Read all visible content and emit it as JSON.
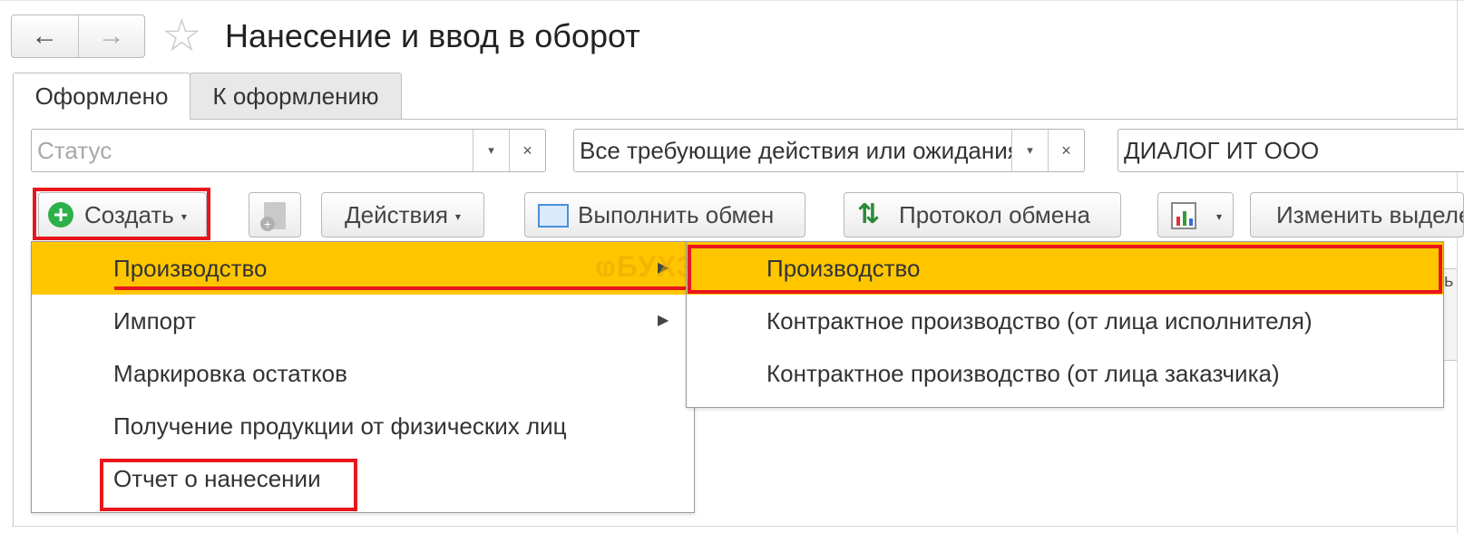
{
  "window": {
    "title": "Нанесение и ввод в оборот",
    "nav": {
      "back_icon": "←",
      "forward_icon": "→"
    },
    "star_icon": "☆"
  },
  "tabs": [
    {
      "label": "Оформлено",
      "active": true
    },
    {
      "label": "К оформлению",
      "active": false
    }
  ],
  "filters": {
    "status": {
      "value": "",
      "placeholder": "Статус"
    },
    "state": {
      "value": "Все требующие действия или ожидания"
    },
    "organization": {
      "value": "ДИАЛОГ ИТ ООО"
    },
    "dropdown_glyph": "▾",
    "clear_glyph": "×"
  },
  "toolbar": {
    "create_label": "Создать",
    "actions_label": "Действия",
    "exchange_label": "Выполнить обмен",
    "protocol_label": "Протокол обмена",
    "change_label": "Изменить выделенные",
    "dropdown_glyph": "▾",
    "plus_glyph": "+"
  },
  "create_menu": {
    "items": [
      {
        "label": "Производство",
        "has_submenu": true,
        "highlighted": true
      },
      {
        "label": "Импорт",
        "has_submenu": true,
        "highlighted": false
      },
      {
        "label": "Маркировка остатков",
        "has_submenu": false,
        "highlighted": false
      },
      {
        "label": "Получение продукции от физических лиц",
        "has_submenu": false,
        "highlighted": false
      },
      {
        "label": "Отчет о нанесении",
        "has_submenu": false,
        "highlighted": false
      }
    ],
    "submenu_arrow": "▶"
  },
  "submenu": {
    "items": [
      {
        "label": "Производство",
        "highlighted": true
      },
      {
        "label": "Контрактное производство (от лица исполнителя)",
        "highlighted": false
      },
      {
        "label": "Контрактное производство (от лица заказчика)",
        "highlighted": false
      }
    ]
  },
  "watermark": "ⱷБУХЭКСПЕРТ",
  "background_fragment": "ь",
  "colors": {
    "highlight": "#ffc600",
    "annotation_red": "#e8161c",
    "create_icon_green": "#2bb04a"
  }
}
